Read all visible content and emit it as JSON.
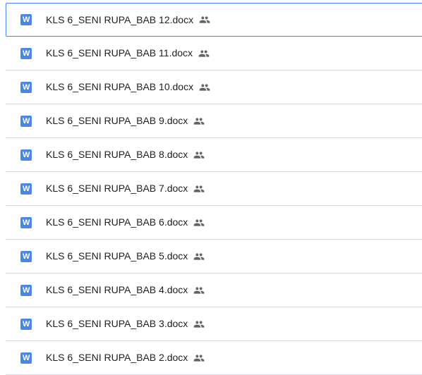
{
  "files": [
    {
      "name": "KLS 6_SENI RUPA_BAB 12.docx",
      "type_icon": "word-doc-icon",
      "type_letter": "W",
      "shared": true,
      "selected": true
    },
    {
      "name": "KLS 6_SENI RUPA_BAB 11.docx",
      "type_icon": "word-doc-icon",
      "type_letter": "W",
      "shared": true,
      "selected": false
    },
    {
      "name": "KLS 6_SENI RUPA_BAB 10.docx",
      "type_icon": "word-doc-icon",
      "type_letter": "W",
      "shared": true,
      "selected": false
    },
    {
      "name": "KLS 6_SENI RUPA_BAB 9.docx",
      "type_icon": "word-doc-icon",
      "type_letter": "W",
      "shared": true,
      "selected": false
    },
    {
      "name": "KLS 6_SENI RUPA_BAB 8.docx",
      "type_icon": "word-doc-icon",
      "type_letter": "W",
      "shared": true,
      "selected": false
    },
    {
      "name": "KLS 6_SENI RUPA_BAB 7.docx",
      "type_icon": "word-doc-icon",
      "type_letter": "W",
      "shared": true,
      "selected": false
    },
    {
      "name": "KLS 6_SENI RUPA_BAB 6.docx",
      "type_icon": "word-doc-icon",
      "type_letter": "W",
      "shared": true,
      "selected": false
    },
    {
      "name": "KLS 6_SENI RUPA_BAB 5.docx",
      "type_icon": "word-doc-icon",
      "type_letter": "W",
      "shared": true,
      "selected": false
    },
    {
      "name": "KLS 6_SENI RUPA_BAB 4.docx",
      "type_icon": "word-doc-icon",
      "type_letter": "W",
      "shared": true,
      "selected": false
    },
    {
      "name": "KLS 6_SENI RUPA_BAB 3.docx",
      "type_icon": "word-doc-icon",
      "type_letter": "W",
      "shared": true,
      "selected": false
    },
    {
      "name": "KLS 6_SENI RUPA_BAB 2.docx",
      "type_icon": "word-doc-icon",
      "type_letter": "W",
      "shared": true,
      "selected": false
    }
  ],
  "colors": {
    "word_icon": "#4a86e8",
    "selected_border": "#4285f4",
    "divider": "#dadce0",
    "text": "#202124",
    "shared_icon": "#5f6368"
  }
}
